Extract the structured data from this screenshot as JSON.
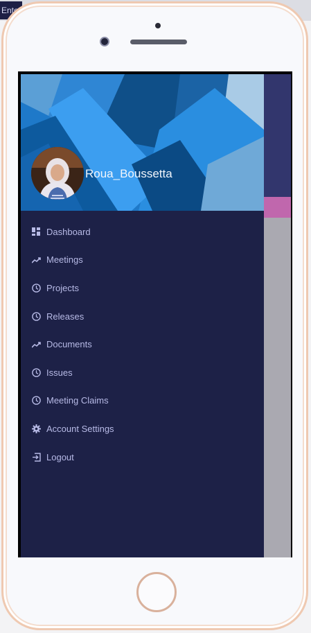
{
  "top_input": {
    "value": "Ente"
  },
  "profile": {
    "username": "Roua_Boussetta"
  },
  "menu": {
    "items": [
      {
        "label": "Dashboard",
        "icon": "dashboard-icon"
      },
      {
        "label": "Meetings",
        "icon": "trending-up-icon"
      },
      {
        "label": "Projects",
        "icon": "clock-icon"
      },
      {
        "label": "Releases",
        "icon": "clock-icon"
      },
      {
        "label": "Documents",
        "icon": "trending-up-icon"
      },
      {
        "label": "Issues",
        "icon": "clock-icon"
      },
      {
        "label": "Meeting Claims",
        "icon": "clock-icon"
      },
      {
        "label": "Account Settings",
        "icon": "gear-icon"
      },
      {
        "label": "Logout",
        "icon": "logout-icon"
      }
    ]
  },
  "colors": {
    "drawer_bg": "#1d2147",
    "menu_text": "#b7bae6",
    "accent_pink": "#c067ad",
    "panel_top": "#32366d"
  }
}
